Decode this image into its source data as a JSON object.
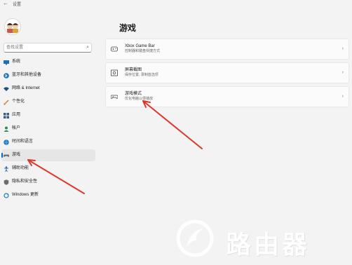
{
  "window": {
    "back_glyph": "←",
    "title": "设置"
  },
  "search": {
    "placeholder": "查找设置",
    "icon": "search-icon"
  },
  "sidebar": {
    "items": [
      {
        "label": "系统",
        "icon": "monitor-icon",
        "color": "#1f6fb5",
        "selected": false
      },
      {
        "label": "蓝牙和其他设备",
        "icon": "bluetooth-icon",
        "color": "#1f6fb5",
        "selected": false
      },
      {
        "label": "网络 & Internet",
        "icon": "wifi-icon",
        "color": "#1a4f86",
        "selected": false
      },
      {
        "label": "个性化",
        "icon": "brush-icon",
        "color": "#d07a2c",
        "selected": false
      },
      {
        "label": "应用",
        "icon": "apps-icon",
        "color": "#3c5c82",
        "selected": false
      },
      {
        "label": "帐户",
        "icon": "account-icon",
        "color": "#2e8b57",
        "selected": false
      },
      {
        "label": "时间和语言",
        "icon": "globe-icon",
        "color": "#1f78c1",
        "selected": false
      },
      {
        "label": "游戏",
        "icon": "gamepad-icon",
        "color": "#6d6d6d",
        "selected": true
      },
      {
        "label": "辅助功能",
        "icon": "accessibility-icon",
        "color": "#2a6fb0",
        "selected": false
      },
      {
        "label": "隐私和安全性",
        "icon": "shield-icon",
        "color": "#6d6d6d",
        "selected": false
      },
      {
        "label": "Windows 更新",
        "icon": "update-icon",
        "color": "#1f78c1",
        "selected": false
      }
    ]
  },
  "main": {
    "title": "游戏",
    "cards": [
      {
        "title": "Xbox Game Bar",
        "subtitle": "控制器和键盘快捷方式",
        "icon": "xbox-bar-icon"
      },
      {
        "title": "屏幕截图",
        "subtitle": "保存位置, 录制首选项",
        "icon": "capture-icon"
      },
      {
        "title": "游戏模式",
        "subtitle": "优化电脑以便播放",
        "icon": "game-mode-icon"
      }
    ],
    "chevron_glyph": "›"
  },
  "annotations": {
    "arrow_color": "#e0352b"
  },
  "watermark": {
    "text": "路由器"
  }
}
